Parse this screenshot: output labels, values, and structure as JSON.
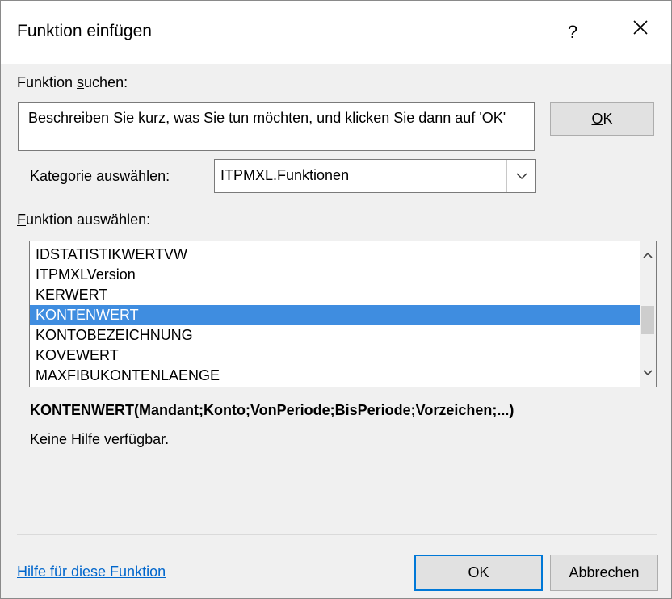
{
  "window": {
    "title": "Funktion einfügen",
    "help_glyph": "?",
    "close_glyph": "✕"
  },
  "search": {
    "label_underline": "s",
    "label_prefix": "Funktion ",
    "label_suffix": "uchen:",
    "value": "Beschreiben Sie kurz, was Sie tun möchten, und klicken Sie dann auf 'OK'",
    "ok_mnemonic": "O",
    "ok_rest": "K"
  },
  "category": {
    "label_mnemonic": "K",
    "label_rest": "ategorie auswählen:",
    "selected": "ITPMXL.Funktionen"
  },
  "function_list": {
    "label_mnemonic": "F",
    "label_rest": "unktion auswählen:",
    "items": [
      {
        "label": "IDSTATISTIKWERTVW",
        "selected": false
      },
      {
        "label": "ITPMXLVersion",
        "selected": false
      },
      {
        "label": "KERWERT",
        "selected": false
      },
      {
        "label": "KONTENWERT",
        "selected": true
      },
      {
        "label": "KONTOBEZEICHNUNG",
        "selected": false
      },
      {
        "label": "KOVEWERT",
        "selected": false
      },
      {
        "label": "MAXFIBUKONTENLAENGE",
        "selected": false
      }
    ]
  },
  "description": {
    "signature": "KONTENWERT(Mandant;Konto;VonPeriode;BisPeriode;Vorzeichen;...)",
    "help": "Keine Hilfe verfügbar."
  },
  "footer": {
    "help_link": "Hilfe für diese Funktion",
    "ok_label": "OK",
    "cancel_label": "Abbrechen"
  },
  "colors": {
    "selection": "#3f8de0",
    "link": "#0066cc",
    "default_button_border": "#0078d7"
  }
}
